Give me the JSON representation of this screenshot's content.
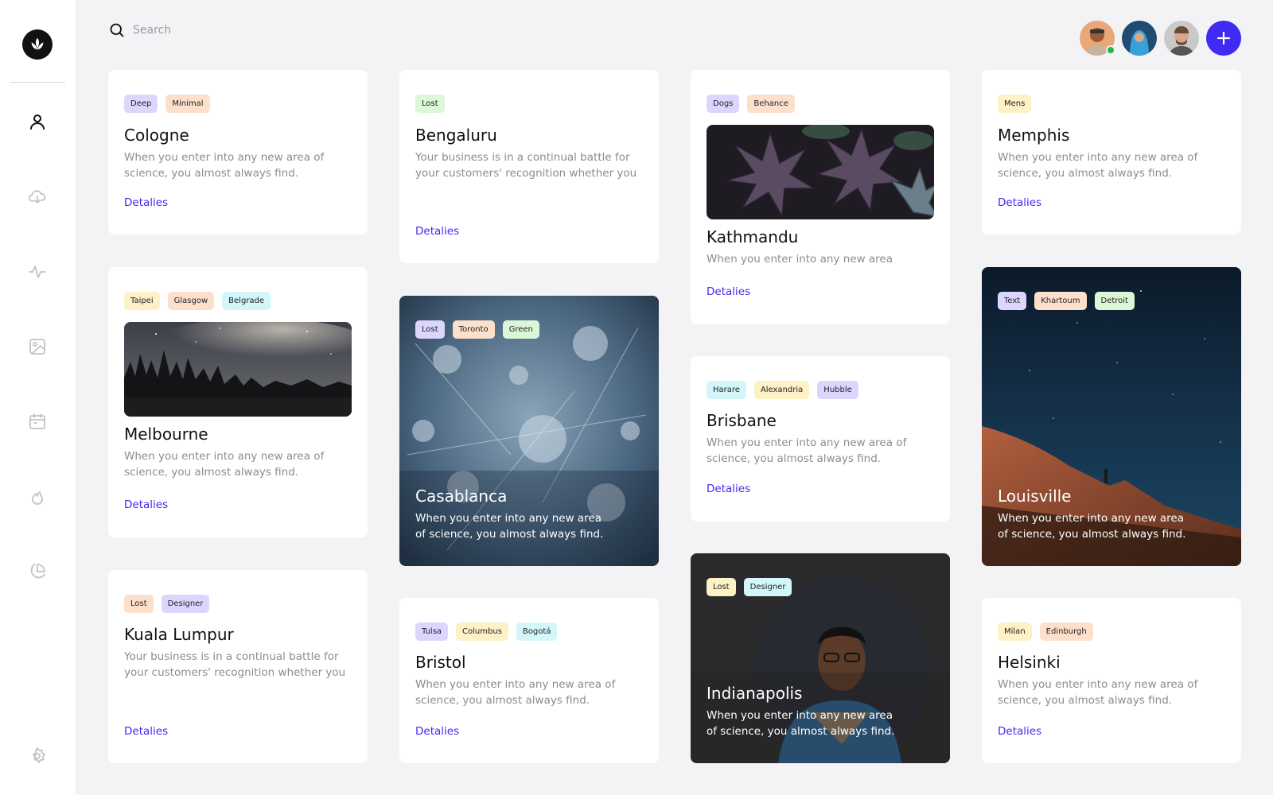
{
  "search": {
    "placeholder": "Search"
  },
  "cards": {
    "cologne": {
      "tags": [
        "Deep",
        "Minimal"
      ],
      "title": "Cologne",
      "desc": "When you enter into any new area of science, you almost always find.",
      "link": "Detalies"
    },
    "bengaluru": {
      "tags": [
        "Lost"
      ],
      "title": "Bengaluru",
      "desc": "Your business is in a continual battle for your customers' recognition whether you",
      "link": "Detalies"
    },
    "kathmandu": {
      "tags": [
        "Dogs",
        "Behance"
      ],
      "title": "Kathmandu",
      "desc": "When you enter into any new area",
      "link": "Detalies"
    },
    "memphis": {
      "tags": [
        "Mens"
      ],
      "title": "Memphis",
      "desc": "When you enter into any new area of science, you almost always find.",
      "link": "Detalies"
    },
    "melbourne": {
      "tags": [
        "Taipei",
        "Glasgow",
        "Belgrade"
      ],
      "title": "Melbourne",
      "desc": "When you enter into any new area of science, you almost always find.",
      "link": "Detalies"
    },
    "casablanca": {
      "tags": [
        "Lost",
        "Toronto",
        "Green"
      ],
      "title": "Casablanca",
      "desc": "When you enter into any new area of science, you almost always find."
    },
    "brisbane": {
      "tags": [
        "Harare",
        "Alexandria",
        "Hubble"
      ],
      "title": "Brisbane",
      "desc": "When you enter into any new area of science, you almost always find.",
      "link": "Detalies"
    },
    "louisville": {
      "tags": [
        "Text",
        "Khartoum",
        "Detroit"
      ],
      "title": "Louisville",
      "desc": "When you enter into any new area of science, you almost always find."
    },
    "kualalumpur": {
      "tags": [
        "Lost",
        "Designer"
      ],
      "title": "Kuala Lumpur",
      "desc": "Your business is in a continual battle for your customers' recognition whether you",
      "link": "Detalies"
    },
    "bristol": {
      "tags": [
        "Tulsa",
        "Columbus",
        "Bogotá"
      ],
      "title": "Bristol",
      "desc": "When you enter into any new area of science, you almost always find.",
      "link": "Detalies"
    },
    "indianapolis": {
      "tags": [
        "Lost",
        "Designer"
      ],
      "title": "Indianapolis",
      "desc": "When you enter into any new area of science, you almost always find."
    },
    "helsinki": {
      "tags": [
        "Milan",
        "Edinburgh"
      ],
      "title": "Helsinki",
      "desc": "When you enter into any new area of science, you almost always find.",
      "link": "Detalies"
    }
  },
  "colors": {
    "accent": "#3f2bf2",
    "online": "#1fb94a"
  }
}
